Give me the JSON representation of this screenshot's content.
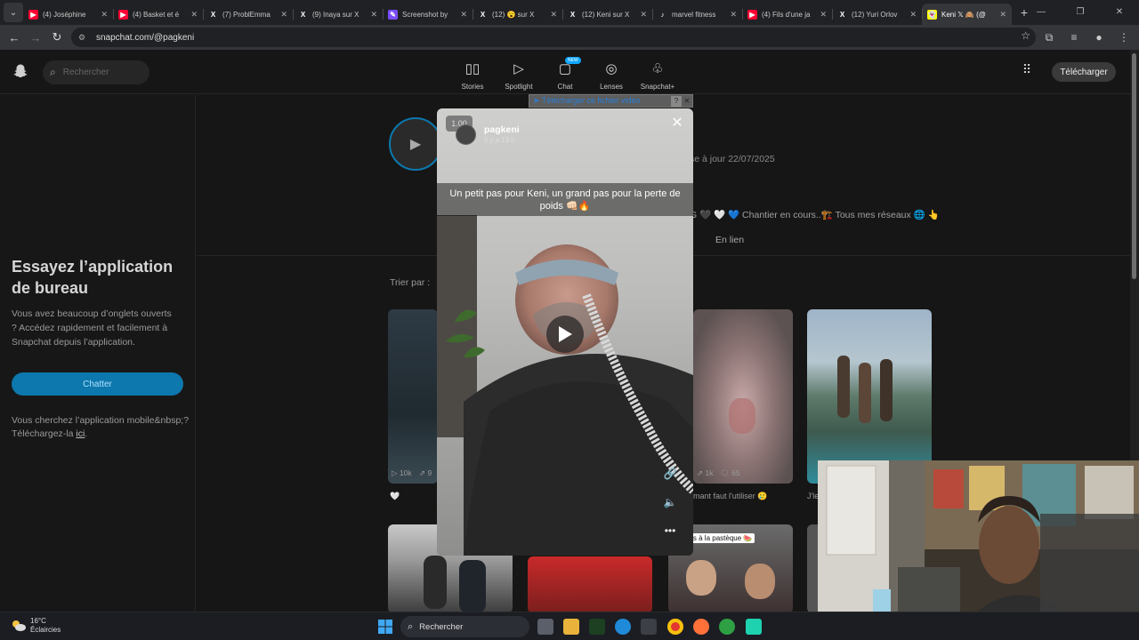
{
  "browser": {
    "tabs": [
      {
        "title": "(4) Joséphine",
        "icon": "youtube-icon",
        "color": "#ff0033",
        "glyph": "▶"
      },
      {
        "title": "(4) Basket et é",
        "icon": "youtube-icon",
        "color": "#ff0033",
        "glyph": "▶"
      },
      {
        "title": "(7) ProblEmma",
        "icon": "x-icon",
        "color": "#202124",
        "glyph": "X"
      },
      {
        "title": "(9) Inaya sur X",
        "icon": "x-icon",
        "color": "#202124",
        "glyph": "X"
      },
      {
        "title": "Screenshot by",
        "icon": "pen-icon",
        "color": "#7b4dff",
        "glyph": "✎"
      },
      {
        "title": "(12) 😮 sur X",
        "icon": "x-icon",
        "color": "#202124",
        "glyph": "X"
      },
      {
        "title": "(12) Keni sur X",
        "icon": "x-icon",
        "color": "#202124",
        "glyph": "X"
      },
      {
        "title": "marvel fitness",
        "icon": "tiktok-icon",
        "color": "#202124",
        "glyph": "♪"
      },
      {
        "title": "(4) Fils d'une ja",
        "icon": "youtube-icon",
        "color": "#ff0033",
        "glyph": "▶"
      },
      {
        "title": "(12) Yuri Orlov",
        "icon": "x-icon",
        "color": "#202124",
        "glyph": "X"
      },
      {
        "title": "Keni 𝕏 🙈 (@",
        "icon": "snapchat-icon",
        "color": "#fffc00",
        "glyph": "👻",
        "active": true
      }
    ],
    "url": "snapchat.com/@pagkeni"
  },
  "snap": {
    "search_placeholder": "Rechercher",
    "nav": [
      {
        "label": "Stories",
        "icon": "stories-icon",
        "glyph": "▯▯"
      },
      {
        "label": "Spotlight",
        "icon": "spotlight-icon",
        "glyph": "▷"
      },
      {
        "label": "Chat",
        "icon": "chat-icon",
        "glyph": "▢",
        "badge": "NEW"
      },
      {
        "label": "Lenses",
        "icon": "lenses-icon",
        "glyph": "◎"
      },
      {
        "label": "Snapchat+",
        "icon": "snapchat-plus-icon",
        "glyph": "♧"
      }
    ],
    "download_button": "Télécharger",
    "sidebar": {
      "title": "Essayez l’application de bureau",
      "desc": "Vous avez beaucoup d’onglets ouverts ? Accédez rapidement et facilement à Snapchat depuis l’application.",
      "chat_button": "Chatter",
      "mobile_text": "Vous cherchez l’application mobile&nbsp;? Téléchargez-la",
      "mobile_link": "ici",
      "mobile_end": "."
    },
    "profile": {
      "update_text": "se à jour 22/07/2025",
      "bio": "G 🖤 🤍 💙 Chantier en cours..🏗️ Tous mes réseaux 🌐 👆",
      "link_tab": "En lien",
      "sort_label": "Trier par :"
    },
    "cards": [
      {
        "views": "▷ 10k",
        "shares": "⇗ 9",
        "caption": "🤍"
      },
      {
        "views": "⇗ 1k",
        "comments": "🗨 65",
        "caption": "mant faut l'utiliser 🥲"
      },
      {
        "caption": "J'le"
      },
      {
        "overlay_text": "Glaces à la pastèque 🍉"
      }
    ]
  },
  "modal": {
    "download_bar": "➤ Télécharger ce fichier vidéo",
    "download_help": "?",
    "speed": "1.00",
    "username": "pagkeni",
    "time": "Il y a 13 h",
    "caption": "Un petit pas pour Keni, un grand pas pour la perte de poids 👊🏻🔥",
    "close": "✕"
  },
  "taskbar": {
    "temp": "16°C",
    "weather": "Éclaircies",
    "search": "Rechercher"
  },
  "colors": {
    "accent_blue": "#0d78ad",
    "snap_yellow": "#fffc00"
  }
}
